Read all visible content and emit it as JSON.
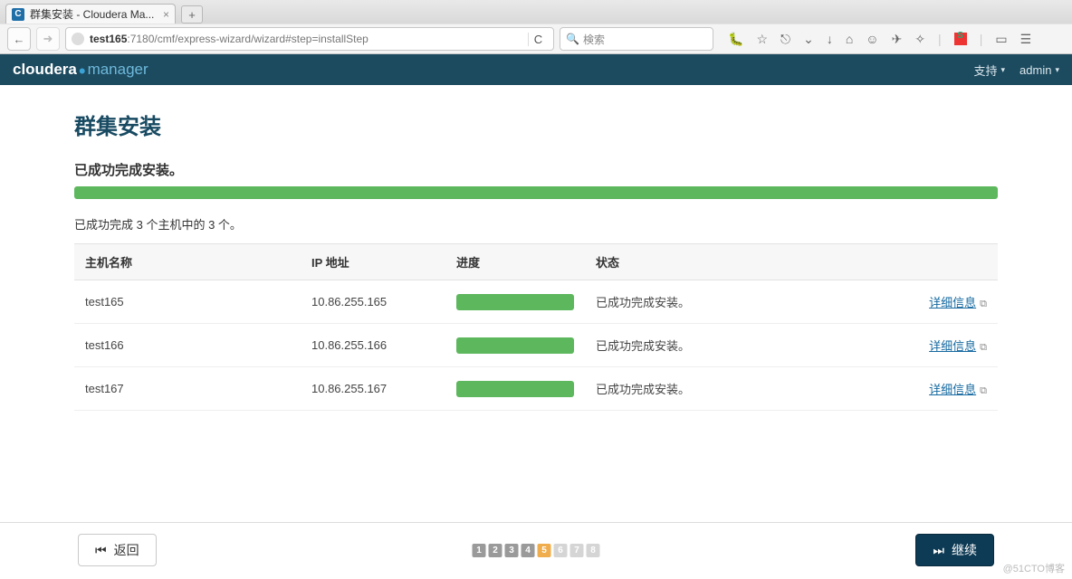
{
  "browser": {
    "tab_title": "群集安装 - Cloudera Ma...",
    "url_host": "test165",
    "url_path": ":7180/cmf/express-wizard/wizard#step=installStep",
    "search_placeholder": "検索"
  },
  "header": {
    "brand1": "cloudera",
    "brand2": "manager",
    "support": "支持",
    "admin": "admin"
  },
  "page": {
    "title": "群集安装",
    "subtitle": "已成功完成安装。",
    "summary": "已成功完成 3 个主机中的 3 个。"
  },
  "table": {
    "headers": {
      "host": "主机名称",
      "ip": "IP 地址",
      "progress": "进度",
      "status": "状态"
    },
    "rows": [
      {
        "host": "test165",
        "ip": "10.86.255.165",
        "status": "已成功完成安装。",
        "detail": "详细信息"
      },
      {
        "host": "test166",
        "ip": "10.86.255.166",
        "status": "已成功完成安装。",
        "detail": "详细信息"
      },
      {
        "host": "test167",
        "ip": "10.86.255.167",
        "status": "已成功完成安装。",
        "detail": "详细信息"
      }
    ]
  },
  "footer": {
    "back": "返回",
    "next": "继续",
    "steps": [
      "1",
      "2",
      "3",
      "4",
      "5",
      "6",
      "7",
      "8"
    ],
    "current_step": 5
  },
  "watermark": "@51CTO博客"
}
